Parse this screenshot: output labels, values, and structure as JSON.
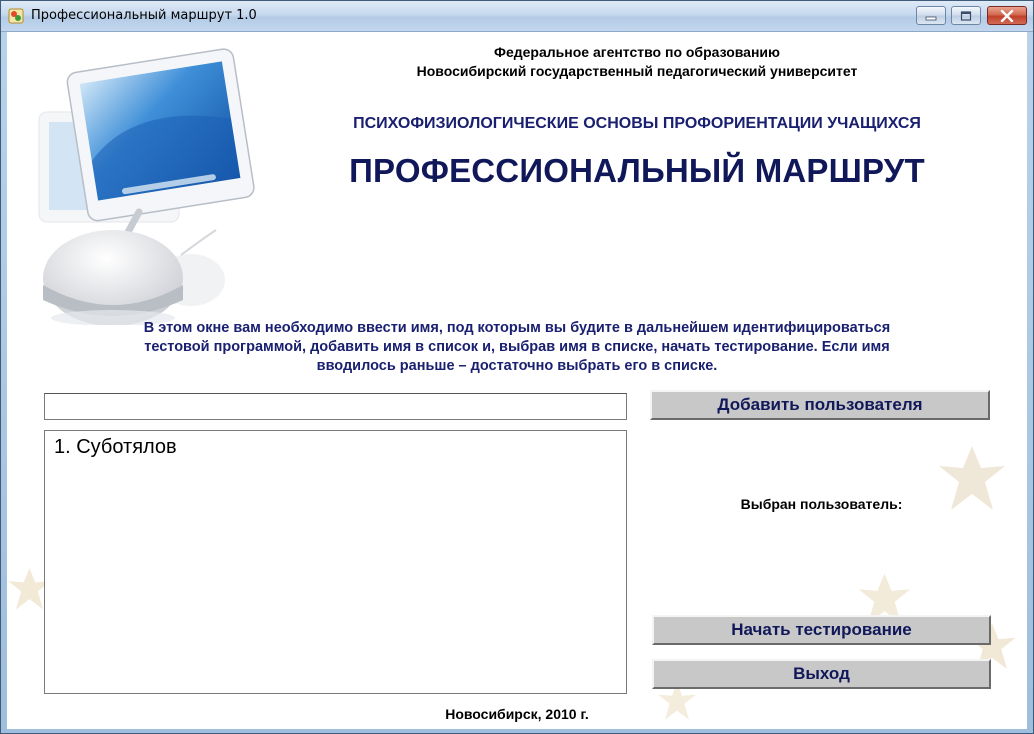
{
  "window": {
    "title": "Профессиональный маршрут 1.0",
    "icons": {
      "app": "app-icon",
      "minimize": "minimize-icon",
      "maximize": "maximize-icon",
      "close": "close-icon"
    }
  },
  "header": {
    "org_line1": "Федеральное агентство по образованию",
    "org_line2": "Новосибирский государственный педагогический университет",
    "subtitle": "ПСИХОФИЗИОЛОГИЧЕСКИЕ ОСНОВЫ ПРОФОРИЕНТАЦИИ УЧАЩИХСЯ",
    "title": "ПРОФЕССИОНАЛЬНЫЙ МАРШРУТ"
  },
  "instructions": {
    "line1": "В этом окне вам необходимо ввести имя, под которым вы будите в дальнейшем идентифицироваться",
    "line2": "тестовой программой, добавить имя в список и, выбрав имя в списке, начать тестирование. Если имя",
    "line3": "вводилось раньше – достаточно выбрать его в списке."
  },
  "form": {
    "name_value": "",
    "add_button_label": "Добавить пользователя",
    "users": [
      "1.  Суботялов"
    ],
    "selected_label": "Выбран пользователь:",
    "start_button_label": "Начать тестирование",
    "exit_button_label": "Выход"
  },
  "footer": {
    "text": "Новосибирск, 2010 г."
  },
  "colors": {
    "title_navy": "#10185a",
    "subtitle_blue": "#1a2070",
    "button_gray": "#c8c8c8",
    "leaf_beige": "#efe3c8"
  }
}
